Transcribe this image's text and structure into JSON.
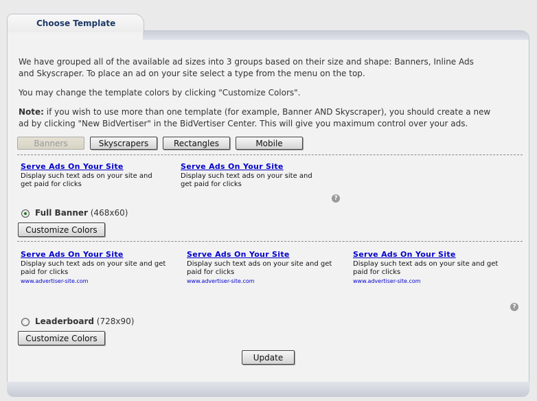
{
  "tab": {
    "title": "Choose Template"
  },
  "intro": {
    "p1_line1": "We have grouped all of the available ad sizes into 3 groups based on their size and shape: Banners, Inline Ads",
    "p1_line2": "and Skyscraper. To place an ad on your site select a type from the menu on the top.",
    "p2": "You may change the template colors by clicking \"Customize Colors\".",
    "note_label": "Note:",
    "note_line1": " if you wish to use more than one template (for example, Banner AND Skyscraper), you should create a new",
    "note_line2": "ad by clicking \"New BidVertiser\" in the BidVertiser Center. This will give you maximum control over your ads."
  },
  "type_tabs": [
    {
      "label": "Banners",
      "disabled": true
    },
    {
      "label": "Skyscrapers"
    },
    {
      "label": "Rectangles"
    },
    {
      "label": "Mobile"
    }
  ],
  "full_banner": {
    "ads": [
      {
        "title": "Serve Ads On Your Site",
        "desc1": "Display such text ads on your site and",
        "desc2": "get paid for clicks"
      },
      {
        "title": "Serve Ads On Your Site",
        "desc1": "Display such text ads on your site and",
        "desc2": "get paid for clicks"
      }
    ],
    "help": "?",
    "option_name": "Full Banner",
    "option_size": " (468x60)",
    "selected": true,
    "customize_label": "Customize Colors"
  },
  "leaderboard": {
    "ads": [
      {
        "title": "Serve Ads On Your Site",
        "desc1": "Display such text ads on your site and get",
        "desc2": "paid for clicks",
        "url": "www.advertiser-site.com"
      },
      {
        "title": "Serve Ads On Your Site",
        "desc1": "Display such text ads on your site and get",
        "desc2": "paid for clicks",
        "url": "www.advertiser-site.com"
      },
      {
        "title": "Serve Ads On Your Site",
        "desc1": "Display such text ads on your site and get",
        "desc2": "paid for clicks",
        "url": "www.advertiser-site.com"
      }
    ],
    "help": "?",
    "option_name": "Leaderboard",
    "option_size": " (728x90)",
    "selected": false,
    "customize_label": "Customize Colors"
  },
  "update_label": "Update",
  "colors": {
    "ad_title": "#0000cc",
    "tab_title": "#1d3a66",
    "radio_checked": "#1a7a1a"
  }
}
